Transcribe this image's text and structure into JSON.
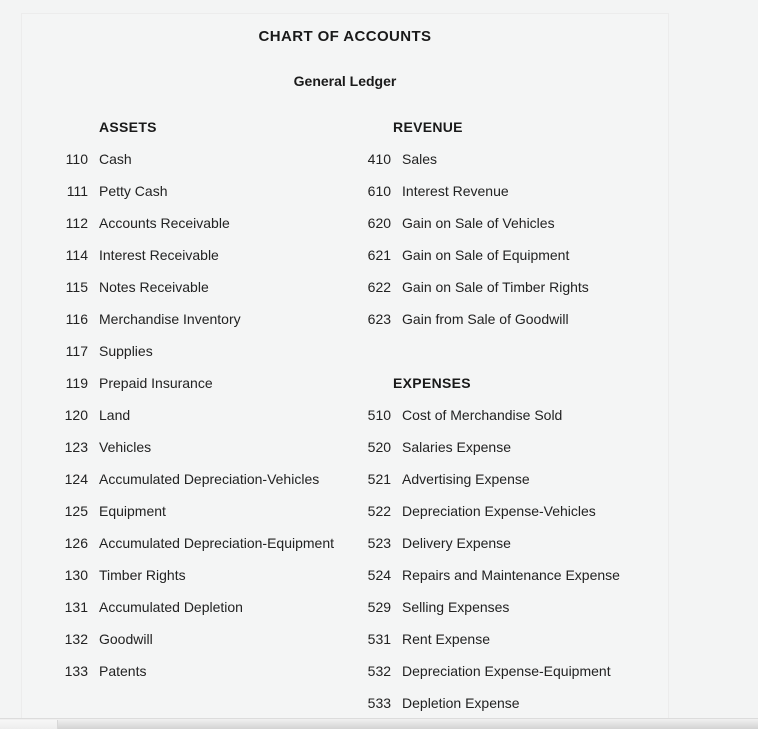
{
  "document": {
    "title": "CHART OF ACCOUNTS",
    "subtitle": "General Ledger"
  },
  "colors": {
    "page_background": "#f3f4f4",
    "panel_background": "#f4f5f5",
    "panel_border": "#ececec",
    "text": "#222222",
    "heading_text": "#1a1a1a"
  },
  "columns": {
    "left": {
      "sections": [
        {
          "heading": "ASSETS",
          "accounts": [
            {
              "number": "110",
              "name": "Cash"
            },
            {
              "number": "111",
              "name": "Petty Cash"
            },
            {
              "number": "112",
              "name": "Accounts Receivable"
            },
            {
              "number": "114",
              "name": "Interest Receivable"
            },
            {
              "number": "115",
              "name": "Notes Receivable"
            },
            {
              "number": "116",
              "name": "Merchandise Inventory"
            },
            {
              "number": "117",
              "name": "Supplies"
            },
            {
              "number": "119",
              "name": "Prepaid Insurance"
            },
            {
              "number": "120",
              "name": "Land"
            },
            {
              "number": "123",
              "name": "Vehicles"
            },
            {
              "number": "124",
              "name": "Accumulated Depreciation-Vehicles"
            },
            {
              "number": "125",
              "name": "Equipment"
            },
            {
              "number": "126",
              "name": "Accumulated Depreciation-Equipment"
            },
            {
              "number": "130",
              "name": "Timber Rights"
            },
            {
              "number": "131",
              "name": "Accumulated Depletion"
            },
            {
              "number": "132",
              "name": "Goodwill"
            },
            {
              "number": "133",
              "name": "Patents"
            }
          ]
        }
      ]
    },
    "right": {
      "sections": [
        {
          "heading": "REVENUE",
          "accounts": [
            {
              "number": "410",
              "name": "Sales"
            },
            {
              "number": "610",
              "name": "Interest Revenue"
            },
            {
              "number": "620",
              "name": "Gain on Sale of Vehicles"
            },
            {
              "number": "621",
              "name": "Gain on Sale of Equipment"
            },
            {
              "number": "622",
              "name": "Gain on Sale of Timber Rights"
            },
            {
              "number": "623",
              "name": "Gain from Sale of Goodwill"
            }
          ]
        },
        {
          "heading": "EXPENSES",
          "accounts": [
            {
              "number": "510",
              "name": "Cost of Merchandise Sold"
            },
            {
              "number": "520",
              "name": "Salaries Expense"
            },
            {
              "number": "521",
              "name": "Advertising Expense"
            },
            {
              "number": "522",
              "name": "Depreciation Expense-Vehicles"
            },
            {
              "number": "523",
              "name": "Delivery Expense"
            },
            {
              "number": "524",
              "name": "Repairs and Maintenance Expense"
            },
            {
              "number": "529",
              "name": "Selling Expenses"
            },
            {
              "number": "531",
              "name": "Rent Expense"
            },
            {
              "number": "532",
              "name": "Depreciation Expense-Equipment"
            },
            {
              "number": "533",
              "name": "Depletion Expense"
            }
          ]
        }
      ]
    }
  }
}
